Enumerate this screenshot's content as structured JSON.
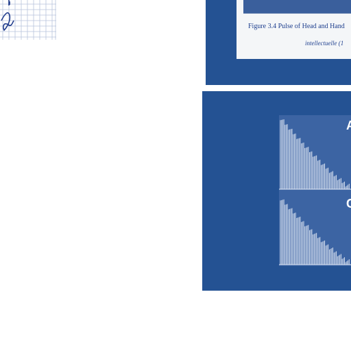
{
  "figure": {
    "caption": "Figure 3.4 Pulse of Head and Hand",
    "credit": "intellectuelle (1"
  },
  "waveform": {
    "labels": [
      "A",
      "C"
    ]
  },
  "colors": {
    "panel": "#245293",
    "ink": "#1e3f8e",
    "waveform": "#e6ecf7",
    "grid": "#b7c3dc"
  }
}
